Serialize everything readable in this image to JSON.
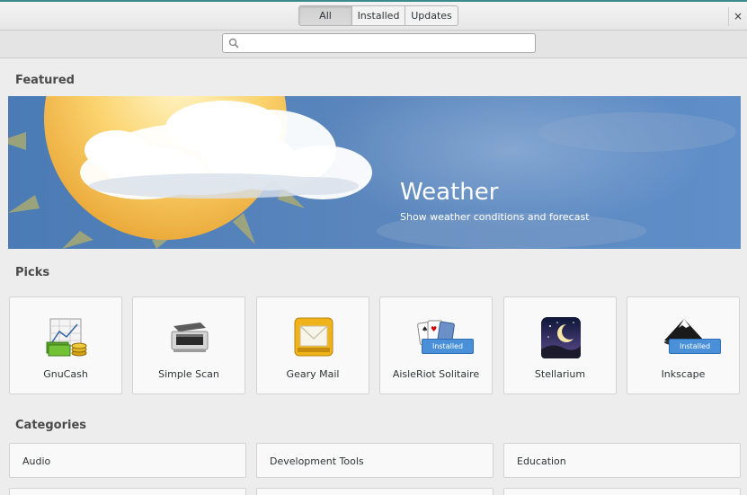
{
  "header": {
    "tabs": [
      {
        "label": "All",
        "active": true
      },
      {
        "label": "Installed",
        "active": false
      },
      {
        "label": "Updates",
        "active": false
      }
    ],
    "close_glyph": "×"
  },
  "search": {
    "placeholder": "",
    "value": ""
  },
  "sections": {
    "featured": "Featured",
    "picks": "Picks",
    "categories": "Categories"
  },
  "featured": {
    "title": "Weather",
    "subtitle": "Show weather conditions and forecast"
  },
  "picks": [
    {
      "label": "GnuCash",
      "icon": "gnucash-icon"
    },
    {
      "label": "Simple Scan",
      "icon": "scanner-icon"
    },
    {
      "label": "Geary Mail",
      "icon": "mail-icon"
    },
    {
      "label": "AisleRiot Solitaire",
      "icon": "playing-cards-icon",
      "badge": "Installed"
    },
    {
      "label": "Stellarium",
      "icon": "stellarium-icon"
    },
    {
      "label": "Inkscape",
      "icon": "inkscape-icon",
      "badge": "Installed"
    }
  ],
  "categories": [
    {
      "label": "Audio"
    },
    {
      "label": "Development Tools"
    },
    {
      "label": "Education"
    }
  ],
  "colors": {
    "accent": "#4a90d9",
    "window_border": "#3c8a8a",
    "banner_blue": "#5a86bd"
  }
}
